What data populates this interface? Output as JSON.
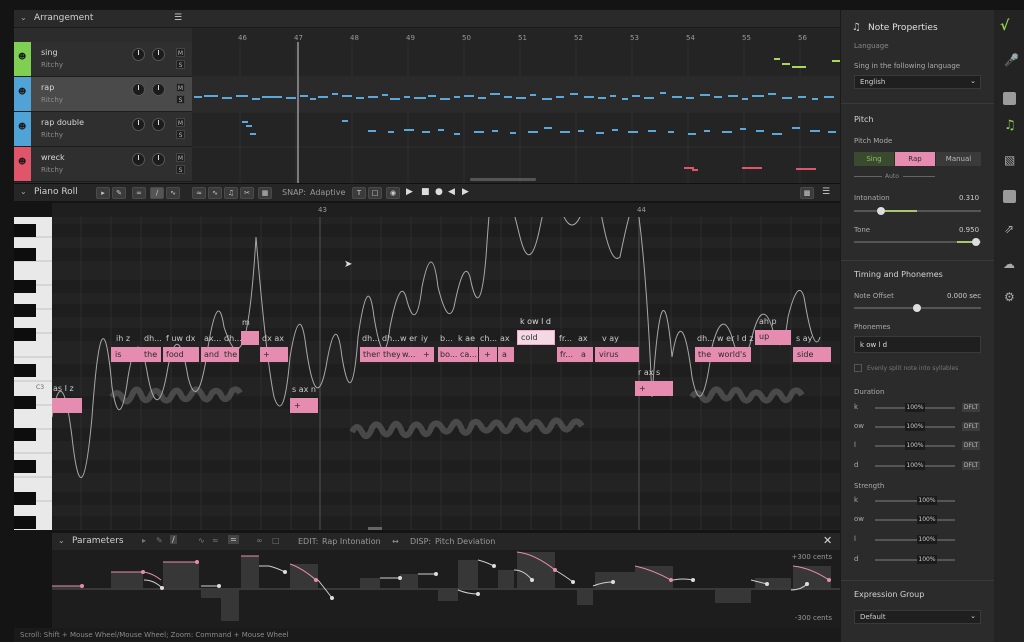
{
  "arrangement": {
    "title": "Arrangement",
    "bar_numbers": [
      "46",
      "47",
      "48",
      "49",
      "50",
      "51",
      "52",
      "53",
      "54",
      "55",
      "56"
    ],
    "tracks": [
      {
        "name": "sing",
        "singer": "Ritchy",
        "color": "#7fcf52",
        "mute": "M",
        "solo": "S"
      },
      {
        "name": "rap",
        "singer": "Ritchy",
        "color": "#4fa3d6",
        "mute": "M",
        "solo": "S"
      },
      {
        "name": "rap double",
        "singer": "Ritchy",
        "color": "#4fa3d6",
        "mute": "M",
        "solo": "S"
      },
      {
        "name": "wreck",
        "singer": "Ritchy",
        "color": "#e05569",
        "mute": "M",
        "solo": "S"
      }
    ]
  },
  "piano_roll": {
    "title": "Piano Roll",
    "snap_label": "SNAP:",
    "snap_value": "Adaptive",
    "bar_numbers": [
      "43",
      "44"
    ],
    "notes": [
      {
        "phon": "as I z",
        "lyric": ""
      },
      {
        "phon": "ih z",
        "lyric": "is"
      },
      {
        "phon": "dh...",
        "lyric": "the"
      },
      {
        "phon": "f uw dx",
        "lyric": "food"
      },
      {
        "phon": "ax...",
        "lyric": "and"
      },
      {
        "phon": "dh...",
        "lyric": "the"
      },
      {
        "phon": "m",
        "lyric": ""
      },
      {
        "phon": "dx ax",
        "lyric": "+"
      },
      {
        "phon": "s ax n",
        "lyric": "+"
      },
      {
        "phon": "dh...",
        "lyric": "then"
      },
      {
        "phon": "dh...",
        "lyric": "they"
      },
      {
        "phon": "w er",
        "lyric": "w..."
      },
      {
        "phon": "iy",
        "lyric": "+"
      },
      {
        "phon": "b...",
        "lyric": "bo..."
      },
      {
        "phon": "k ae",
        "lyric": "ca..."
      },
      {
        "phon": "ch...",
        "lyric": "+"
      },
      {
        "phon": "ax",
        "lyric": "a"
      },
      {
        "phon": "k ow l d",
        "lyric": "cold"
      },
      {
        "phon": "fr...",
        "lyric": "fr..."
      },
      {
        "phon": "ax",
        "lyric": "a"
      },
      {
        "phon": "v ay",
        "lyric": "virus"
      },
      {
        "phon": "r ax s",
        "lyric": "+"
      },
      {
        "phon": "dh...",
        "lyric": "the"
      },
      {
        "phon": "w er l d z",
        "lyric": "world's"
      },
      {
        "phon": "ah p",
        "lyric": "up"
      },
      {
        "phon": "s ay",
        "lyric": "side"
      }
    ]
  },
  "parameters": {
    "title": "Parameters",
    "edit_label": "EDIT:",
    "edit_value": "Rap Intonation",
    "disp_label": "DISP:",
    "disp_value": "Pitch Deviation",
    "top_value": "+300 cents",
    "bottom_value": "-300 cents"
  },
  "status_bar": "Scroll: Shift + Mouse Wheel/Mouse Wheel; Zoom: Command + Mouse Wheel",
  "note_properties": {
    "title": "Note Properties",
    "language_header": "Language",
    "language_hint": "Sing in the following language",
    "language_value": "English",
    "pitch_header": "Pitch",
    "pitch_mode_label": "Pitch Mode",
    "pitch_modes": [
      "Sing",
      "Rap",
      "Manual"
    ],
    "pitch_mode_selected": "Rap",
    "auto_label": "Auto",
    "intonation_label": "Intonation",
    "intonation_value": "0.310",
    "tone_label": "Tone",
    "tone_value": "0.950",
    "timing_header": "Timing and Phonemes",
    "note_offset_label": "Note Offset",
    "note_offset_value": "0.000 sec",
    "phonemes_label": "Phonemes",
    "phonemes_value": "k ow l d",
    "split_label": "Evenly split note into syllables",
    "duration_label": "Duration",
    "strength_label": "Strength",
    "phoneme_rows": [
      "k",
      "ow",
      "l",
      "d"
    ],
    "duration_values": [
      "100%",
      "100%",
      "100%",
      "100%"
    ],
    "strength_values": [
      "100%",
      "100%",
      "100%",
      "100%"
    ],
    "dflt_label": "DFLT",
    "expression_header": "Expression Group",
    "expression_value": "Default"
  }
}
